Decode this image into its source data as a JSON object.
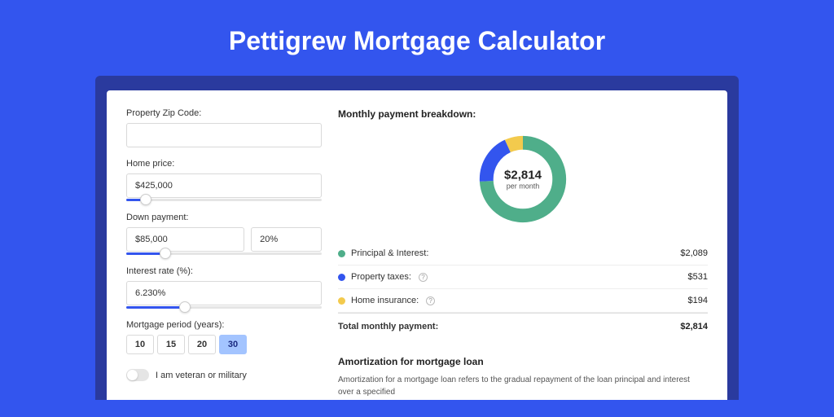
{
  "page_title": "Pettigrew Mortgage Calculator",
  "form": {
    "zip_label": "Property Zip Code:",
    "zip_value": "",
    "home_price_label": "Home price:",
    "home_price_value": "$425,000",
    "home_price_slider_pct": 10,
    "down_payment_label": "Down payment:",
    "down_payment_value": "$85,000",
    "down_payment_pct_value": "20%",
    "down_payment_slider_pct": 20,
    "interest_label": "Interest rate (%):",
    "interest_value": "6.230%",
    "interest_slider_pct": 30,
    "period_label": "Mortgage period (years):",
    "periods": [
      "10",
      "15",
      "20",
      "30"
    ],
    "period_selected": "30",
    "veteran_label": "I am veteran or military",
    "veteran_on": false
  },
  "breakdown": {
    "title": "Monthly payment breakdown:",
    "center_amount": "$2,814",
    "center_sub": "per month",
    "items": [
      {
        "label": "Principal & Interest:",
        "value": "$2,089",
        "color": "#4fae8a",
        "help": false,
        "pct": 74
      },
      {
        "label": "Property taxes:",
        "value": "$531",
        "color": "#3355ee",
        "help": true,
        "pct": 19
      },
      {
        "label": "Home insurance:",
        "value": "$194",
        "color": "#f3ca4d",
        "help": true,
        "pct": 7
      }
    ],
    "total_label": "Total monthly payment:",
    "total_value": "$2,814"
  },
  "amortization": {
    "title": "Amortization for mortgage loan",
    "text": "Amortization for a mortgage loan refers to the gradual repayment of the loan principal and interest over a specified"
  },
  "chart_data": {
    "type": "pie",
    "title": "Monthly payment breakdown",
    "series": [
      {
        "name": "Principal & Interest",
        "value": 2089,
        "color": "#4fae8a"
      },
      {
        "name": "Property taxes",
        "value": 531,
        "color": "#3355ee"
      },
      {
        "name": "Home insurance",
        "value": 194,
        "color": "#f3ca4d"
      }
    ],
    "total": 2814,
    "center_label": "$2,814 per month"
  }
}
